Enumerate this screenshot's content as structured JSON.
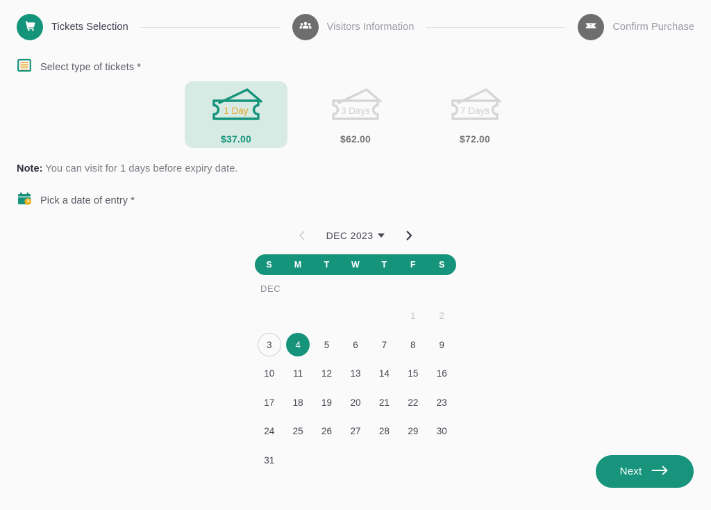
{
  "stepper": {
    "steps": [
      {
        "label": "Tickets Selection",
        "icon": "shopping-cart-icon",
        "state": "active"
      },
      {
        "label": "Visitors Information",
        "icon": "people-group-icon",
        "state": "inactive"
      },
      {
        "label": "Confirm Purchase",
        "icon": "ticket-stub-icon",
        "state": "inactive"
      }
    ]
  },
  "tickets_section": {
    "label": "Select type of tickets *",
    "icon": "ticket-list-icon",
    "options": [
      {
        "days_label": "1 Day",
        "price": "$37.00",
        "selected": true
      },
      {
        "days_label": "3 Days",
        "price": "$62.00",
        "selected": false
      },
      {
        "days_label": "7 Days",
        "price": "$72.00",
        "selected": false
      }
    ]
  },
  "note": {
    "prefix": "Note:",
    "text": " You can visit for 1 days before expiry date."
  },
  "date_section": {
    "label": "Pick a date of entry *",
    "icon": "calendar-clock-icon"
  },
  "calendar": {
    "month_label": "DEC 2023",
    "month_tag": "DEC",
    "prev_arrow": "chevron-left-icon",
    "next_arrow": "chevron-right-icon",
    "weekdays": [
      "S",
      "M",
      "T",
      "W",
      "T",
      "F",
      "S"
    ],
    "leading_blanks": 5,
    "days": [
      {
        "n": "1",
        "state": "muted"
      },
      {
        "n": "2",
        "state": "muted"
      },
      {
        "n": "3",
        "state": "today"
      },
      {
        "n": "4",
        "state": "selected"
      },
      {
        "n": "5",
        "state": "normal"
      },
      {
        "n": "6",
        "state": "normal"
      },
      {
        "n": "7",
        "state": "normal"
      },
      {
        "n": "8",
        "state": "normal"
      },
      {
        "n": "9",
        "state": "normal"
      },
      {
        "n": "10",
        "state": "normal"
      },
      {
        "n": "11",
        "state": "normal"
      },
      {
        "n": "12",
        "state": "normal"
      },
      {
        "n": "13",
        "state": "normal"
      },
      {
        "n": "14",
        "state": "normal"
      },
      {
        "n": "15",
        "state": "normal"
      },
      {
        "n": "16",
        "state": "normal"
      },
      {
        "n": "17",
        "state": "normal"
      },
      {
        "n": "18",
        "state": "normal"
      },
      {
        "n": "19",
        "state": "normal"
      },
      {
        "n": "20",
        "state": "normal"
      },
      {
        "n": "21",
        "state": "normal"
      },
      {
        "n": "22",
        "state": "normal"
      },
      {
        "n": "23",
        "state": "normal"
      },
      {
        "n": "24",
        "state": "normal"
      },
      {
        "n": "25",
        "state": "normal"
      },
      {
        "n": "26",
        "state": "normal"
      },
      {
        "n": "27",
        "state": "normal"
      },
      {
        "n": "28",
        "state": "normal"
      },
      {
        "n": "29",
        "state": "normal"
      },
      {
        "n": "30",
        "state": "normal"
      },
      {
        "n": "31",
        "state": "normal"
      }
    ]
  },
  "footer": {
    "next_label": "Next",
    "next_icon": "arrow-right-icon"
  },
  "colors": {
    "brand_green": "#16937b",
    "selected_card_bg": "#d7ebe4",
    "accent_gold": "#e8a72b",
    "inactive_gray": "#6e6e6e",
    "page_bg": "#fafafa"
  }
}
